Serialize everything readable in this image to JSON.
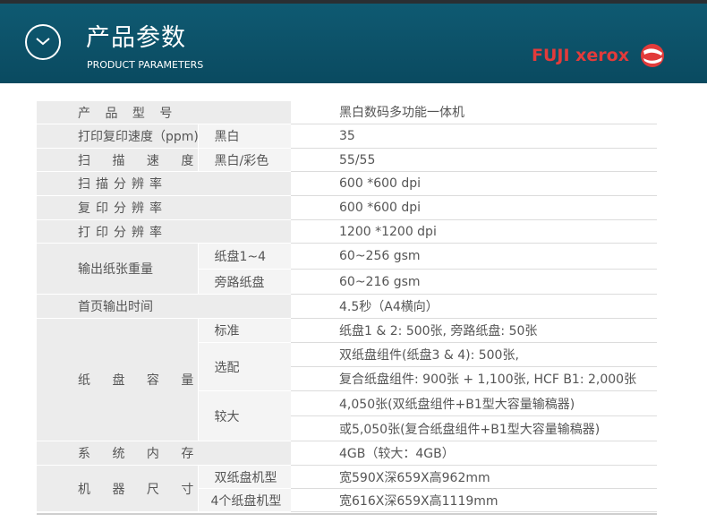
{
  "header": {
    "title_cn": "产品参数",
    "title_en": "PRODUCT PARAMETERS",
    "logo_text": "FUJI xerox",
    "icon": "chevron-down-icon",
    "colors": {
      "bar": "#0c5068",
      "logo": "#e23b3b"
    }
  },
  "specs": {
    "model": {
      "label": "产 品 型 号",
      "value": "黑白数码多功能一体机"
    },
    "print_copy_speed": {
      "label": "打印复印速度（ppm)",
      "sub": "黑白",
      "value": "35"
    },
    "scan_speed": {
      "label": "扫 描 速 度",
      "sub": "黑白/彩色",
      "value": "55/55"
    },
    "scan_res": {
      "label": "扫描分辨率",
      "value": "600 *600 dpi"
    },
    "copy_res": {
      "label": "复印分辨率",
      "value": "600 *600 dpi"
    },
    "print_res": {
      "label": "打印分辨率",
      "value": "1200 *1200 dpi"
    },
    "paper_weight": {
      "label": "输出纸张重量",
      "rows": [
        {
          "sub": "纸盘1~4",
          "value": "60~256 gsm"
        },
        {
          "sub": "旁路纸盘",
          "value": "60~216 gsm"
        }
      ]
    },
    "first_page": {
      "label": "首页输出时间",
      "value": "4.5秒（A4横向）"
    },
    "paper_capacity": {
      "label": "纸 盘 容 量",
      "standard": {
        "sub": "标准",
        "value": "纸盘1 & 2: 500张, 旁路纸盘: 50张"
      },
      "optional": {
        "sub": "选配",
        "value1": "双纸盘组件(纸盘3 & 4): 500张,",
        "value2": "复合纸盘组件: 900张 + 1,100张, HCF B1: 2,000张"
      },
      "max": {
        "sub": "较大",
        "value1": "4,050张(双纸盘组件+B1型大容量输稿器)",
        "value2": "或5,050张(复合纸盘组件+B1型大容量输稿器)"
      }
    },
    "memory": {
      "label": "系 统 内 存",
      "value": "4GB（较大：4GB）"
    },
    "dimensions": {
      "label": "机 器 尺 寸",
      "rows": [
        {
          "sub": "双纸盘机型",
          "value": "宽590X深659X高962mm"
        },
        {
          "sub": "4个纸盘机型",
          "value": "宽616X深659X高1119mm"
        }
      ]
    }
  }
}
